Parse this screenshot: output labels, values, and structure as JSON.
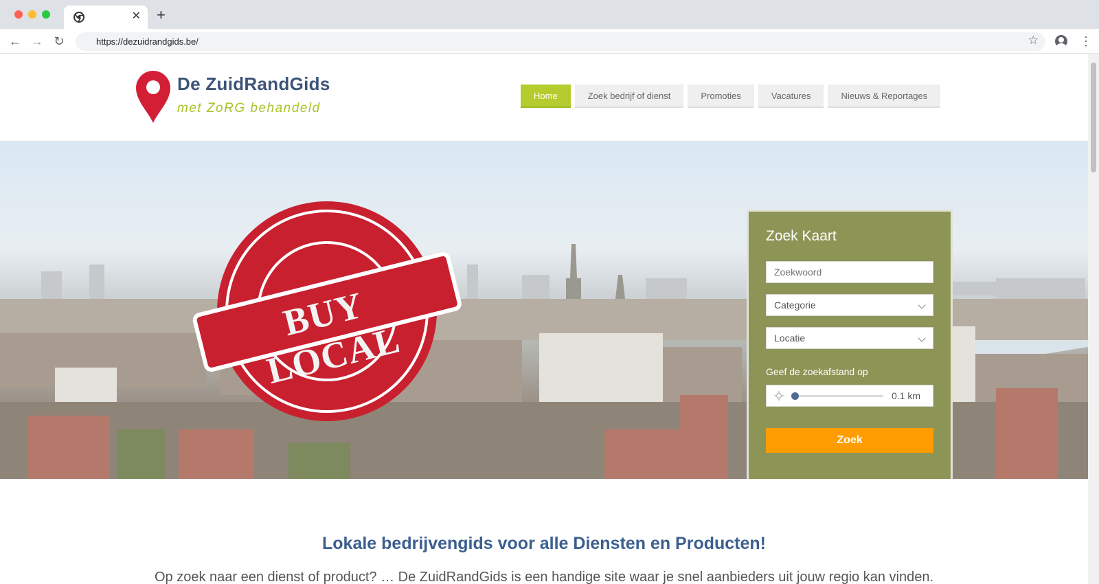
{
  "browser": {
    "url": "https://dezuidrandgids.be/"
  },
  "site": {
    "logo_title": "De ZuidRandGids",
    "logo_tagline": "met ZoRG behandeld",
    "nav": [
      {
        "label": "Home"
      },
      {
        "label": "Zoek bedrijf of dienst"
      },
      {
        "label": "Promoties"
      },
      {
        "label": "Vacatures"
      },
      {
        "label": "Nieuws & Reportages"
      }
    ]
  },
  "hero": {
    "stamp_text": "BUY LOCAL"
  },
  "search": {
    "title": "Zoek Kaart",
    "keyword_placeholder": "Zoekwoord",
    "category_label": "Categorie",
    "location_label": "Locatie",
    "distance_label": "Geef de zoekafstand op",
    "distance_value": "0.1 km",
    "distance_fraction": 0.02,
    "submit_label": "Zoek"
  },
  "content": {
    "headline": "Lokale bedrijvengids voor alle Diensten en Producten!",
    "intro": "Op zoek naar een dienst of product? … De ZuidRandGids is een handige site waar je snel aanbieders uit jouw regio kan vinden."
  },
  "colors": {
    "accent_green": "#b5cc2e",
    "card_olive": "#8d9556",
    "button_orange": "#ff9d00",
    "stamp_red": "#c8202f",
    "headline_blue": "#3c5f8f"
  }
}
